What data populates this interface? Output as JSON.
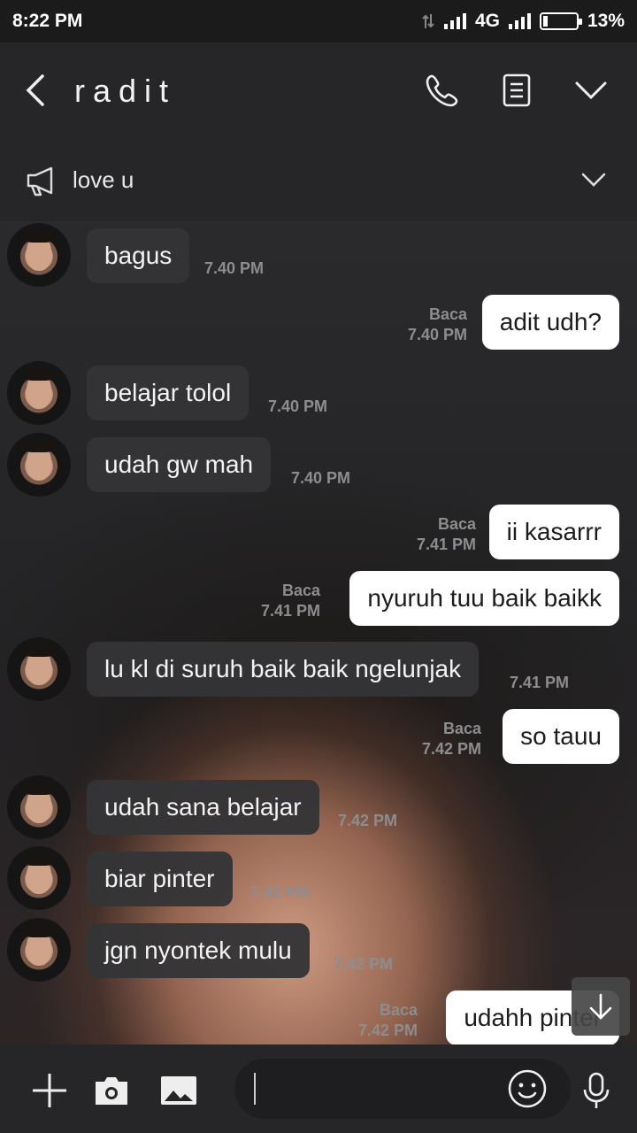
{
  "status": {
    "time": "8:22 PM",
    "network": "4G",
    "battery": "13%"
  },
  "header": {
    "title": "radit"
  },
  "notice": {
    "text": "love u"
  },
  "messages": [
    {
      "dir": "in",
      "text": "bagus",
      "time": "7.40 PM"
    },
    {
      "dir": "out",
      "text": "adit udh?",
      "read": "Baca",
      "time": "7.40 PM"
    },
    {
      "dir": "in",
      "text": "belajar tolol",
      "time": "7.40 PM"
    },
    {
      "dir": "in",
      "text": "udah gw mah",
      "time": "7.40 PM"
    },
    {
      "dir": "out",
      "text": "ii kasarrr",
      "read": "Baca",
      "time": "7.41 PM"
    },
    {
      "dir": "out",
      "text": "nyuruh tuu baik baikk",
      "read": "Baca",
      "time": "7.41 PM"
    },
    {
      "dir": "in",
      "text": "lu kl di suruh baik baik ngelunjak",
      "time": "7.41 PM"
    },
    {
      "dir": "out",
      "text": "so tauu",
      "read": "Baca",
      "time": "7.42 PM"
    },
    {
      "dir": "in",
      "text": "udah sana belajar",
      "time": "7.42 PM"
    },
    {
      "dir": "in",
      "text": "biar pinter",
      "time": "7.42 PM"
    },
    {
      "dir": "in",
      "text": "jgn nyontek mulu",
      "time": "7.42 PM"
    },
    {
      "dir": "out",
      "text": "udahh pinter",
      "read": "Baca",
      "time": "7.42 PM"
    }
  ],
  "icons": {
    "back": "chevron-left-icon",
    "call": "phone-icon",
    "notes": "notes-icon",
    "menu": "chevron-down-icon",
    "megaphone": "megaphone-icon",
    "add": "plus-icon",
    "camera": "camera-icon",
    "gallery": "image-icon",
    "emoji": "emoji-icon",
    "mic": "mic-icon",
    "scroll": "arrow-down-icon"
  }
}
